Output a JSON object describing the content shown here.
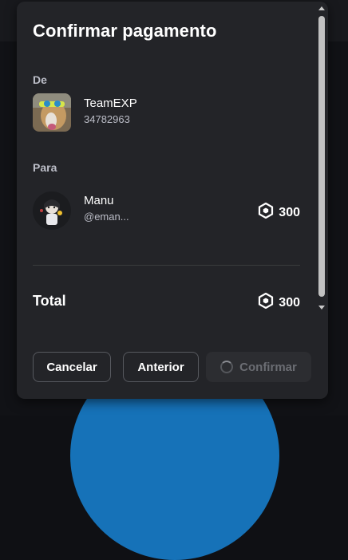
{
  "modal": {
    "title": "Confirmar pagamento",
    "from": {
      "label": "De",
      "name": "TeamEXP",
      "id": "34782963"
    },
    "to": {
      "label": "Para",
      "name": "Manu",
      "handle": "@eman...",
      "amount": "300"
    },
    "total": {
      "label": "Total",
      "amount": "300"
    },
    "buttons": {
      "cancel": "Cancelar",
      "previous": "Anterior",
      "confirm": "Confirmar"
    }
  },
  "icons": {
    "currency": "robux-icon",
    "loading": "spinner-icon"
  },
  "colors": {
    "modal_bg": "#232428",
    "accent_bg": "#1672b8",
    "text_primary": "#ffffff",
    "text_secondary": "#bcbec8",
    "button_disabled": "#6b6d73"
  }
}
